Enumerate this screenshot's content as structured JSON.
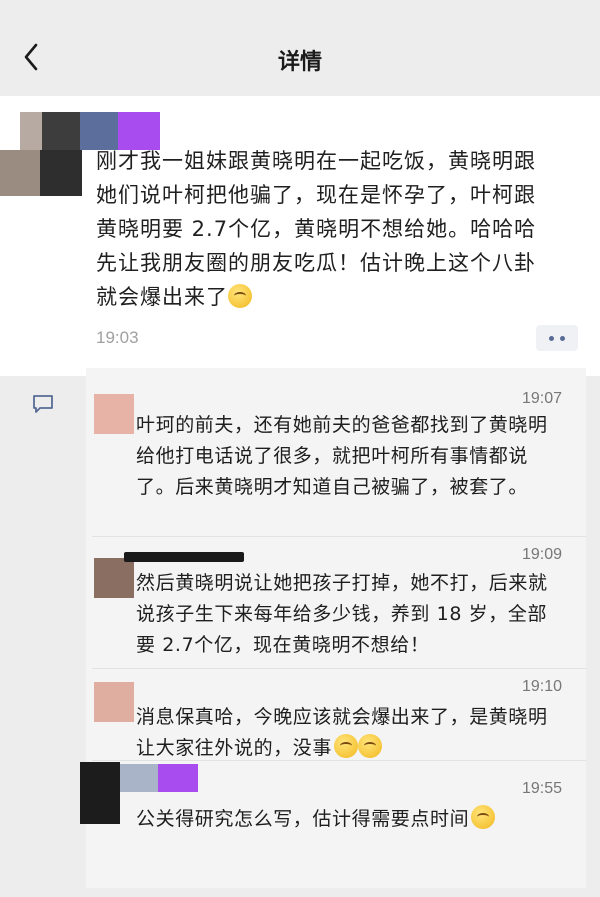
{
  "header": {
    "title": "详情",
    "back_icon": "chevron-left-icon"
  },
  "post": {
    "text_lines": [
      "刚才我一姐妹跟黄晓明在一起吃饭，黄晓明跟",
      "她们说叶柯把他骗了，现在是怀孕了，叶柯跟",
      "黄晓明要 2.7个亿，黄晓明不想给她。哈哈哈",
      "先让我朋友圈的朋友吃瓜！估计晚上这个八卦",
      "就会爆出来了"
    ],
    "time": "19:03"
  },
  "comments": [
    {
      "time": "19:07",
      "text": "叶珂的前夫，还有她前夫的爸爸都找到了黄晓明给他打电话说了很多，就把叶柯所有事情都说了。后来黄晓明才知道自己被骗了，被套了。"
    },
    {
      "time": "19:09",
      "text": "然后黄晓明说让她把孩子打掉，她不打，后来就说孩子生下来每年给多少钱，养到 18 岁，全部要 2.7个亿，现在黄晓明不想给！"
    },
    {
      "time": "19:10",
      "text": "消息保真哈，今晚应该就会爆出来了，是黄晓明让大家往外说的，没事"
    },
    {
      "time": "19:55",
      "text": "公关得研究怎么写，估计得需要点时间"
    }
  ]
}
